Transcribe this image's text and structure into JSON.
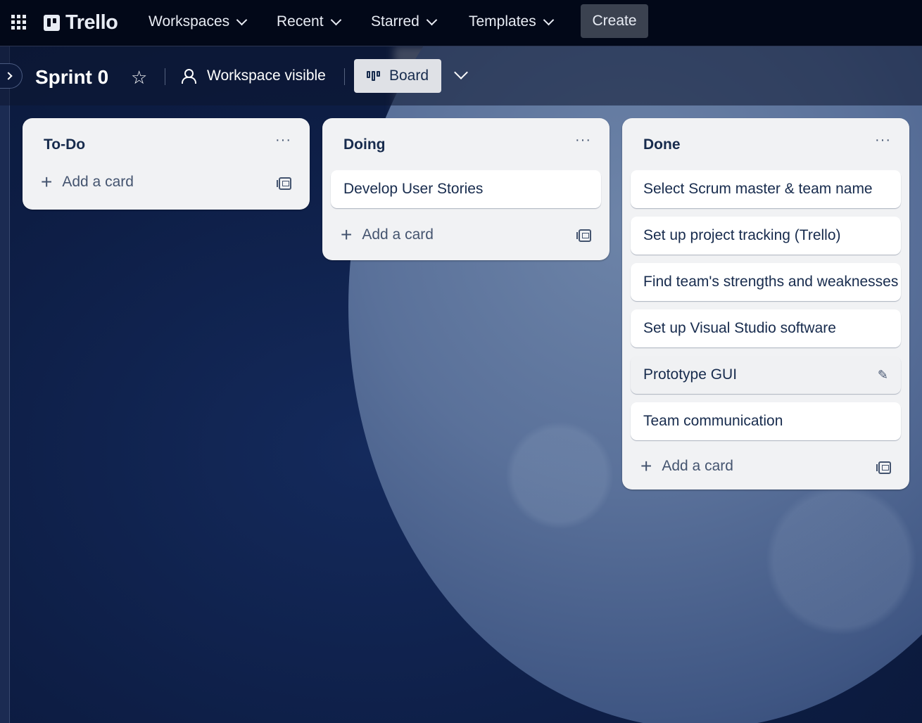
{
  "topnav": {
    "logo_text": "Trello",
    "menus": [
      {
        "label": "Workspaces"
      },
      {
        "label": "Recent"
      },
      {
        "label": "Starred"
      },
      {
        "label": "Templates"
      }
    ],
    "create_label": "Create"
  },
  "board": {
    "title": "Sprint 0",
    "visibility_label": "Workspace visible",
    "view_label": "Board"
  },
  "lists": [
    {
      "title": "To-Do",
      "cards": [],
      "add_label": "Add a card"
    },
    {
      "title": "Doing",
      "cards": [
        {
          "title": "Develop User Stories"
        }
      ],
      "add_label": "Add a card"
    },
    {
      "title": "Done",
      "cards": [
        {
          "title": "Select Scrum master & team name"
        },
        {
          "title": "Set up project tracking (Trello)"
        },
        {
          "title": "Find team's strengths and weaknesses"
        },
        {
          "title": "Set up Visual Studio software"
        },
        {
          "title": "Prototype GUI"
        },
        {
          "title": "Team communication"
        }
      ],
      "add_label": "Add a card"
    }
  ],
  "icons": {
    "menu": "···",
    "star": "☆",
    "edit": "✎"
  }
}
